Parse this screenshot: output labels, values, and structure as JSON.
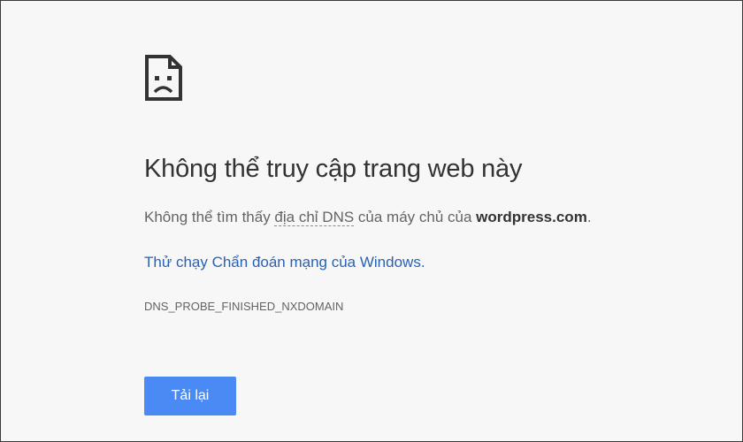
{
  "error_page": {
    "icon": "sad-page-icon",
    "title": "Không thể truy cập trang web này",
    "message": {
      "prefix": "Không thể tìm thấy ",
      "dns_term": "địa chỉ DNS",
      "middle": " của máy chủ của ",
      "host": "wordpress.com",
      "suffix": "."
    },
    "diagnose_link": "Thử chạy Chẩn đoán mạng của Windows.",
    "error_code": "DNS_PROBE_FINISHED_NXDOMAIN",
    "reload_label": "Tải lại"
  },
  "colors": {
    "background": "#f7f7f7",
    "link": "#2a62b3",
    "button": "#4a8af4"
  }
}
